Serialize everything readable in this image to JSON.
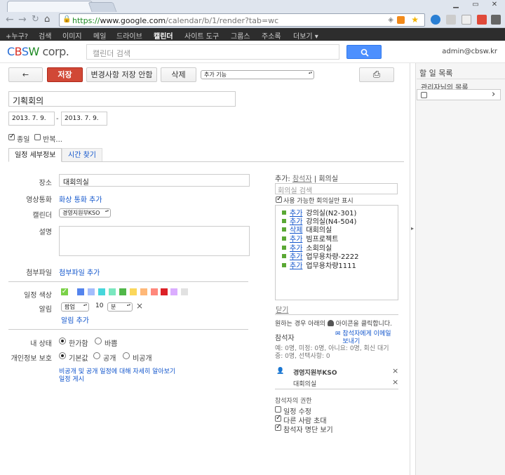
{
  "browser": {
    "url_scheme": "https://",
    "url_host": "www.google.com",
    "url_path": "/calendar/b/1/render?tab=wc"
  },
  "gbar": {
    "items": [
      "+누구?",
      "검색",
      "이미지",
      "메일",
      "드라이브",
      "캘린더",
      "사이트 도구",
      "그룹스",
      "주소록",
      "더보기 ▾"
    ],
    "active_index": 5
  },
  "header": {
    "logo_c": "C",
    "logo_b": "B",
    "logo_s": "S",
    "logo_w": "W",
    "logo_corp": " corp.",
    "search_placeholder": "캘린더 검색",
    "user": "admin@cbsw.kr"
  },
  "toolbar": {
    "back": "←",
    "save": "저장",
    "discard": "변경사항 저장 안함",
    "delete": "삭제",
    "more": "추가 기능",
    "print": "⎙"
  },
  "event": {
    "title": "기획회의",
    "start_date": "2013. 7. 9.",
    "dash": "-",
    "end_date": "2013. 7. 9.",
    "allday": "종일",
    "repeat": "반복..."
  },
  "tabs": {
    "details": "일정 세부정보",
    "find_time": "시간 찾기"
  },
  "form": {
    "where_label": "장소",
    "where_value": "대회의실",
    "video_label": "영상통화",
    "video_link": "화상 통화 추가",
    "calendar_label": "캘린더",
    "calendar_value": "경영지원부KSO",
    "desc_label": "설명",
    "attach_label": "첨부파일",
    "attach_link": "첨부파일 추가",
    "color_label": "일정 색상",
    "colors": [
      "#7bd148",
      "#5484ed",
      "#a4bdfc",
      "#46d6db",
      "#7ae7bf",
      "#51b749",
      "#fbd75b",
      "#ffb878",
      "#ff887c",
      "#dc2127",
      "#dbadff",
      "#e1e1e1"
    ],
    "reminder_label": "알림",
    "reminder_type": "팝업",
    "reminder_value": "10",
    "reminder_unit": "분",
    "reminder_remove": "×",
    "reminder_add": "알림 추가",
    "status_label": "내 상태",
    "status_free": "한가함",
    "status_busy": "바쁨",
    "privacy_label": "개인정보 보호",
    "privacy_default": "기본값",
    "privacy_public": "공개",
    "privacy_private": "비공개",
    "privacy_link1": "비공개 및 공개 일정에 대해 자세히 알아보기",
    "privacy_link2": "일정 게시"
  },
  "rooms": {
    "add_label": "추가:",
    "guests_link": "참석자",
    "pipe": "|",
    "rooms_text": "회의실",
    "search_placeholder": "회의실 검색",
    "show_available": "사용 가능한 회의실만 표시",
    "list": [
      {
        "action": "추가",
        "name": "강의실(N2-301)"
      },
      {
        "action": "추가",
        "name": "강의실(N4-504)"
      },
      {
        "action": "삭제",
        "name": "대회의실"
      },
      {
        "action": "추가",
        "name": "빔프로젝트"
      },
      {
        "action": "추가",
        "name": "소회의실"
      },
      {
        "action": "추가",
        "name": "업무용차량-2222"
      },
      {
        "action": "추가",
        "name": "업무용차량1111"
      }
    ],
    "close": "닫기"
  },
  "guests": {
    "hint": "원하는 경우 아래의",
    "hint2": "아이콘을 클릭합니다.",
    "label": "참석자",
    "email_link": "참석자에게 이메일 보내기",
    "summary": "예: 0명, 미정: 0명, 아니요: 0명, 회신 대기 중: 0명, 선택사항: 0",
    "list": [
      "경영지원부KSO",
      "대회의실"
    ],
    "remove": "×",
    "perm_title": "참석자의 권한",
    "perm_edit": "일정 수정",
    "perm_invite": "다른 사람 초대",
    "perm_see": "참석자 명단 보기"
  },
  "tasks": {
    "title": "할 일 목록",
    "subtitle": "관리자님의 목록",
    "expand": "›"
  }
}
